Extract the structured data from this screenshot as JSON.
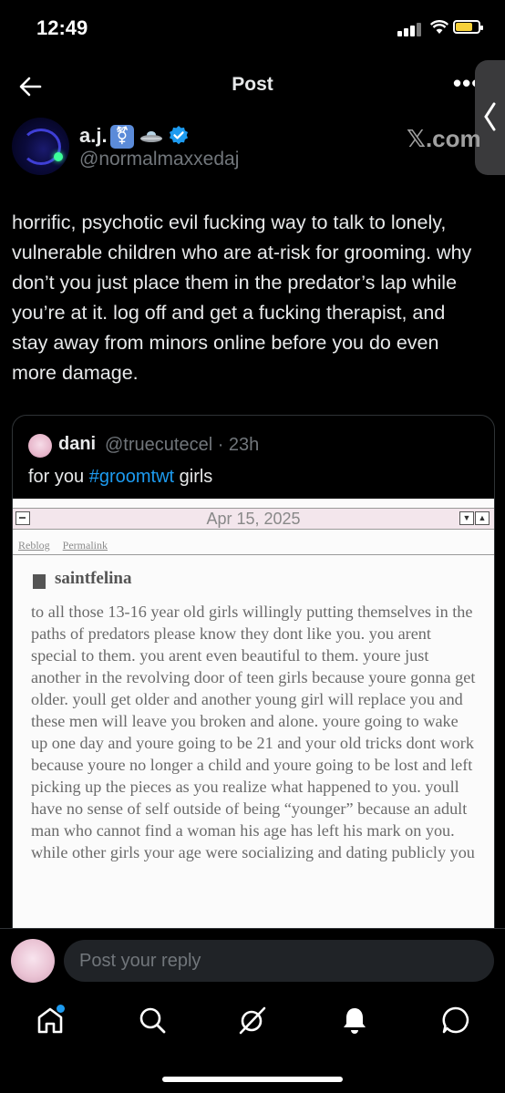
{
  "status": {
    "time": "12:49"
  },
  "header": {
    "title": "Post"
  },
  "author": {
    "name": "a.j.",
    "badge_symbol": "⚧",
    "handle": "@normalmaxxedaj",
    "watermark": "𝕏.com"
  },
  "post": {
    "text": "horrific, psychotic evil fucking way to talk to lonely, vulnerable children who are at-risk for grooming. why don’t you just place them in the predator’s lap while you’re at it. log off and get a fucking therapist, and stay away from minors online before you do even more damage."
  },
  "quote": {
    "name": "dani",
    "handle": "@truecutecel · 23h",
    "text_before": "for you ",
    "hashtag": "#groomtwt",
    "text_after": " girls",
    "screenshot": {
      "date": "Apr 15, 2025",
      "link_reblog": "Reblog",
      "link_permalink": "Permalink",
      "username": "saintfelina",
      "body": "to all those 13-16 year old girls willingly putting themselves in the paths of predators please know they dont like you. you arent special to them. you arent even beautiful to them. youre just another in the revolving door of teen girls because youre gonna get older. youll get older and another young girl will replace you and these men will leave you broken and alone. youre going to wake up one day and youre going to be 21 and your old tricks dont work because youre no longer a child and youre going to be lost and left picking up the pieces as you realize what happened to you. youll have no sense of self outside of being “younger” because an adult man who cannot find a woman his age has left his mark on you. while other girls your age were socializing and dating publicly you"
    }
  },
  "reply": {
    "placeholder": "Post your reply"
  },
  "colors": {
    "accent": "#1d9bf0",
    "background": "#000000",
    "muted": "#71767b"
  }
}
